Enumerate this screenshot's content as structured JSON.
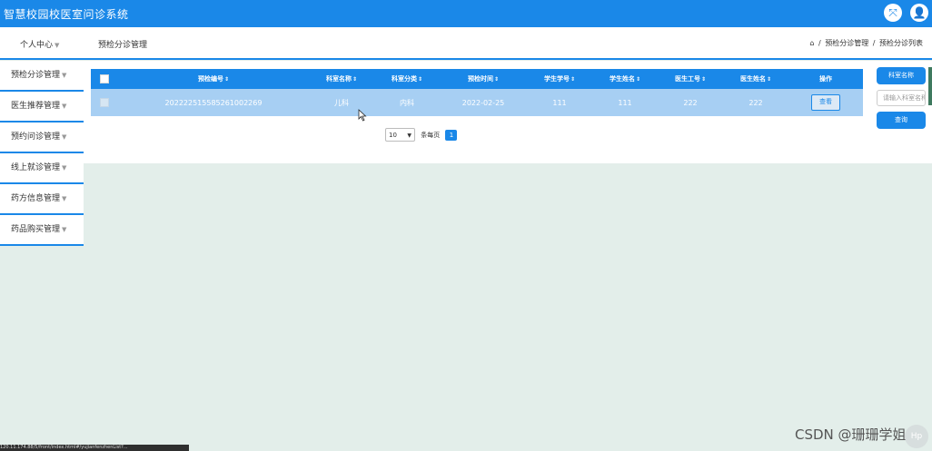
{
  "app": {
    "title": "智慧校园校医室问诊系统"
  },
  "top_icons": [
    {
      "icon": "fullscreen-icon",
      "glyph": "⤧"
    },
    {
      "icon": "user-avatar-icon",
      "glyph": "👤"
    }
  ],
  "subbar": {
    "user_menu": "个人中心",
    "page_title": "预检分诊管理",
    "breadcrumb": {
      "home_icon": "⌂",
      "items": [
        "预检分诊管理",
        "预检分诊列表"
      ],
      "separator": "/"
    }
  },
  "sidebar": {
    "items": [
      {
        "label": "预检分诊管理"
      },
      {
        "label": "医生推荐管理"
      },
      {
        "label": "预约问诊管理"
      },
      {
        "label": "线上就诊管理"
      },
      {
        "label": "药方信息管理"
      },
      {
        "label": "药品购买管理"
      }
    ]
  },
  "table": {
    "columns": [
      "预检编号",
      "科室名称",
      "科室分类",
      "预检时间",
      "学生学号",
      "学生姓名",
      "医生工号",
      "医生姓名",
      "操作"
    ],
    "rows": [
      {
        "cells": [
          "20222251558526100​2269",
          "儿科",
          "内科",
          "2022-02-25",
          "111",
          "111",
          "222",
          "222"
        ],
        "action_label": "查看"
      }
    ]
  },
  "pager": {
    "page_size": "10",
    "page_size_label": "条每页",
    "current_page": "1"
  },
  "search_panel": {
    "field_button": "科室名称",
    "input_placeholder": "请输入科室名称",
    "search_button": "查询"
  },
  "watermark": "CSDN @珊珊学姐",
  "help_bubble": "Hp",
  "status_url": "120.11.174.88/5/front/index.html#/yujianfenzhenList?...",
  "colors": {
    "primary": "#1a88e8",
    "row_bg": "#a7cff3",
    "page_bg": "#e3eeea"
  }
}
